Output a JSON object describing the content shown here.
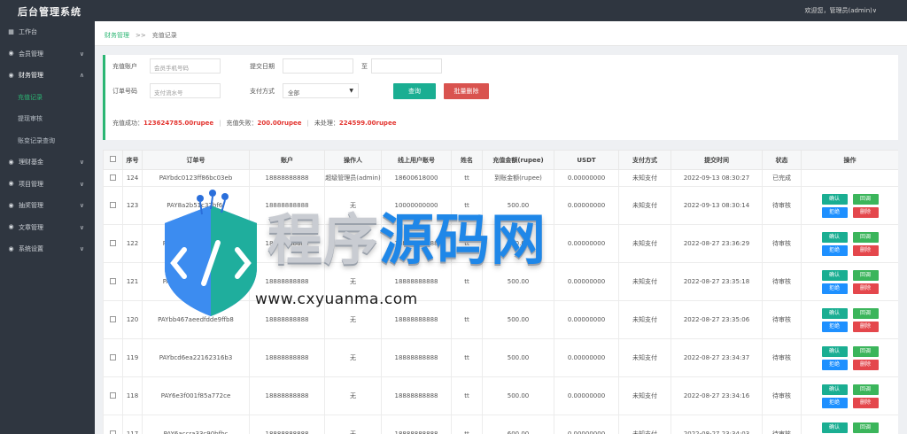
{
  "app": {
    "title": "后台管理系统",
    "user_greeting": "欢迎您，管理员(admin)∨"
  },
  "sidebar": {
    "items": [
      {
        "label": "工作台",
        "icon": "dashboard-icon",
        "chevron": ""
      },
      {
        "label": "会员管理",
        "icon": "user-icon",
        "chevron": "∨"
      },
      {
        "label": "财务管理",
        "icon": "finance-icon",
        "chevron": "∧"
      },
      {
        "label": "充值记录",
        "sub": true,
        "active": true
      },
      {
        "label": "提现审核",
        "sub": true
      },
      {
        "label": "账变记录查询",
        "sub": true
      },
      {
        "label": "理财基金",
        "icon": "fund-icon",
        "chevron": "∨"
      },
      {
        "label": "项目管理",
        "icon": "project-icon",
        "chevron": "∨"
      },
      {
        "label": "抽奖管理",
        "icon": "lottery-icon",
        "chevron": "∨"
      },
      {
        "label": "文章管理",
        "icon": "article-icon",
        "chevron": "∨"
      },
      {
        "label": "系统设置",
        "icon": "settings-icon",
        "chevron": "∨"
      }
    ]
  },
  "breadcrumb": {
    "parent": "财务管理",
    "separator": ">>",
    "current": "充值记录"
  },
  "filter": {
    "account_label": "充值账户",
    "account_placeholder": "会员手机号码",
    "date_label": "提交日期",
    "date_to": "至",
    "order_label": "订单号码",
    "order_placeholder": "支付流水号",
    "pay_method_label": "支付方式",
    "pay_method_value": "全部",
    "search_button": "查询",
    "batch_delete_button": "批量删除"
  },
  "stats": {
    "success_label": "充值成功：",
    "success_value": "123624785.00rupee",
    "fail_label": "充值失败：",
    "fail_value": "200.00rupee",
    "pending_label": "未处理：",
    "pending_value": "224599.00rupee"
  },
  "table": {
    "columns": [
      "",
      "序号",
      "订单号",
      "账户",
      "操作人",
      "线上用户账号",
      "姓名",
      "充值金额(rupee)",
      "USDT",
      "支付方式",
      "提交时间",
      "状态",
      "操作"
    ],
    "first_row": [
      "124",
      "PAYbdc0123ff86bc03eb",
      "18888888888",
      "超级管理员(admin)",
      "18600618000",
      "tt",
      "到账金额(rupee)",
      "0.00000000",
      "未知支付",
      "2022-09-13 08:30:27",
      "已完成"
    ],
    "rows": [
      [
        "123",
        "PAY8a2b51c32bf6f",
        "18888888888",
        "无",
        "10000000000",
        "tt",
        "500.00",
        "0.00000000",
        "未知支付",
        "2022-09-13 08:30:14",
        "待审核"
      ],
      [
        "122",
        "PAYab23c71e0b8f1c3",
        "18888888888",
        "无",
        "18888888888",
        "tt",
        "500.00",
        "0.00000000",
        "未知支付",
        "2022-08-27 23:36:29",
        "待审核"
      ],
      [
        "121",
        "PAY8e3a6a3e6b61f8f",
        "18888888888",
        "无",
        "18888888888",
        "tt",
        "500.00",
        "0.00000000",
        "未知支付",
        "2022-08-27 23:35:18",
        "待审核"
      ],
      [
        "120",
        "PAYbb467aeedfdde9ffb8",
        "18888888888",
        "无",
        "18888888888",
        "tt",
        "500.00",
        "0.00000000",
        "未知支付",
        "2022-08-27 23:35:06",
        "待审核"
      ],
      [
        "119",
        "PAYbcd6ea22162316b3",
        "18888888888",
        "无",
        "18888888888",
        "tt",
        "500.00",
        "0.00000000",
        "未知支付",
        "2022-08-27 23:34:37",
        "待审核"
      ],
      [
        "118",
        "PAY6e3f001f85a772ce",
        "18888888888",
        "无",
        "18888888888",
        "tt",
        "500.00",
        "0.00000000",
        "未知支付",
        "2022-08-27 23:34:16",
        "待审核"
      ],
      [
        "117",
        "PAY6accra33c90bfbc",
        "18888888888",
        "无",
        "18888888888",
        "tt",
        "600.00",
        "0.00000000",
        "未知支付",
        "2022-08-27 23:34:03",
        "待审核"
      ]
    ],
    "actions": {
      "confirm": "确认",
      "rollback": "回调",
      "reject": "拒绝",
      "delete": "删除"
    }
  },
  "watermark": {
    "text_main": "程序",
    "text_accent": "源码网",
    "url": "www.cxyuanma.com"
  },
  "colors": {
    "accent": "#2bb673",
    "danger": "#d9534f",
    "topbar": "#2f3640",
    "stat_value": "#e3342f"
  }
}
